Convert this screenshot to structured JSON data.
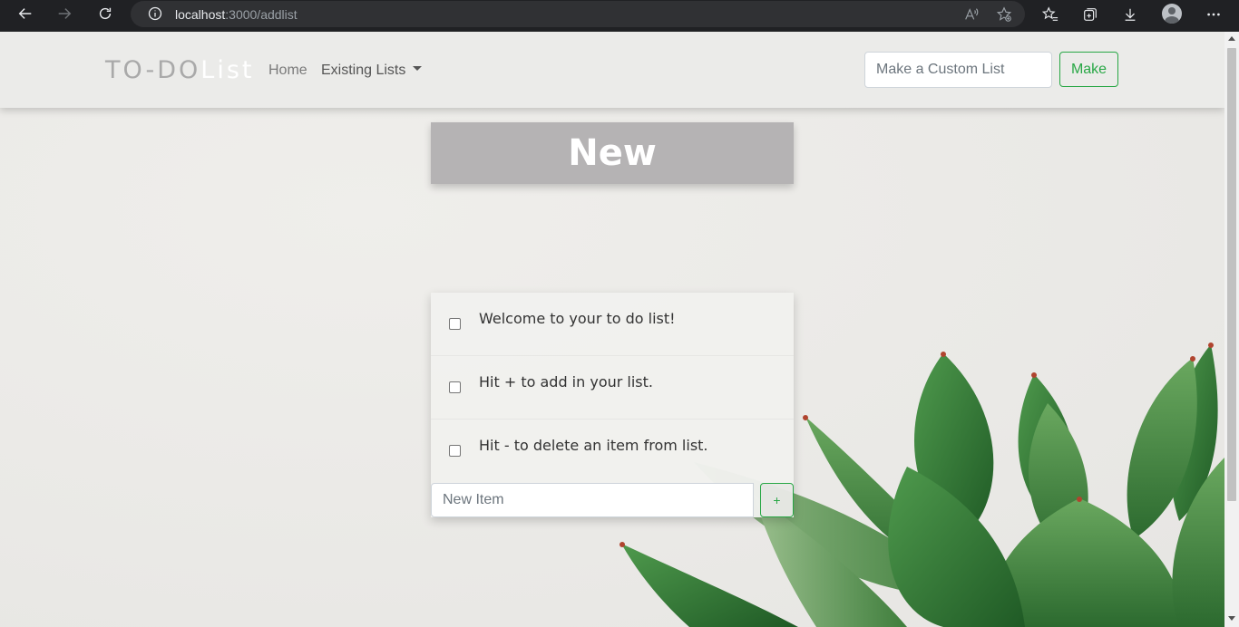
{
  "browser": {
    "url_host": "localhost",
    "url_path": ":3000/addlist",
    "icons": {
      "back": "back-arrow-icon",
      "forward": "forward-arrow-icon",
      "reload": "reload-icon",
      "info": "info-icon",
      "read_aloud": "read-aloud-icon",
      "add_favorite": "add-favorite-icon",
      "favorites": "favorites-icon",
      "collections": "collections-icon",
      "downloads": "download-icon",
      "profile": "profile-avatar-icon",
      "more": "more-icon"
    }
  },
  "navbar": {
    "brand_part1": "TO-DO",
    "brand_part2": "List",
    "home_label": "Home",
    "existing_lists_label": "Existing Lists",
    "custom_list_placeholder": "Make a Custom List",
    "make_label": "Make"
  },
  "heading": {
    "title": "New"
  },
  "list": {
    "items": [
      {
        "text": "Welcome to your to do list!",
        "checked": false
      },
      {
        "text": "Hit + to add in your list.",
        "checked": false
      },
      {
        "text": "Hit - to delete an item from list.",
        "checked": false
      }
    ],
    "new_item_placeholder": "New Item",
    "add_label": "+"
  },
  "colors": {
    "accent_green": "#28a745",
    "heading_bg": "#b5b3b4",
    "chrome_bg": "#202124"
  }
}
